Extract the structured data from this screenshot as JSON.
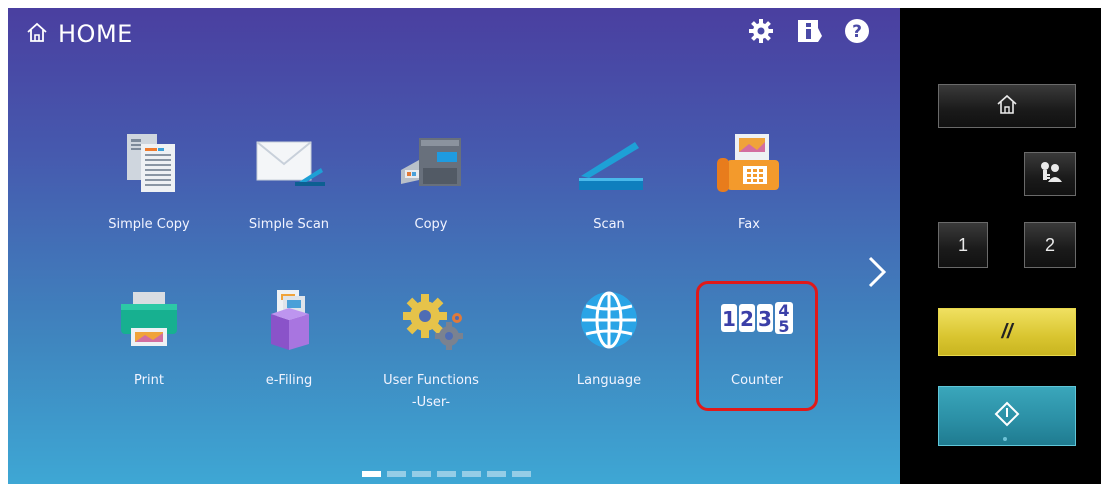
{
  "header": {
    "title": "HOME"
  },
  "apps": [
    {
      "label": "Simple Copy",
      "icon": "simple-copy-icon"
    },
    {
      "label": "Simple Scan",
      "icon": "simple-scan-icon"
    },
    {
      "label": "Copy",
      "icon": "copier-icon"
    },
    {
      "label": "Scan",
      "icon": "scanner-icon"
    },
    {
      "label": "Fax",
      "icon": "fax-icon"
    },
    {
      "label": "Print",
      "icon": "printer-icon"
    },
    {
      "label": "e-Filing",
      "icon": "e-filing-box-icon"
    },
    {
      "label": "User Functions",
      "sublabel": "-User-",
      "icon": "gears-icon"
    },
    {
      "label": "Language",
      "icon": "globe-icon"
    },
    {
      "label": "Counter",
      "icon": "counter-icon",
      "counter_digits": [
        "1",
        "2",
        "3",
        "4",
        "5"
      ]
    }
  ],
  "pager": {
    "pages": 7,
    "active": 1
  },
  "panel": {
    "job_one_label": "1",
    "job_two_label": "2",
    "reset_label": "//"
  },
  "colors": {
    "highlight": "#e01919",
    "reset_button": "#d9c530",
    "start_button": "#2a8ea4"
  }
}
